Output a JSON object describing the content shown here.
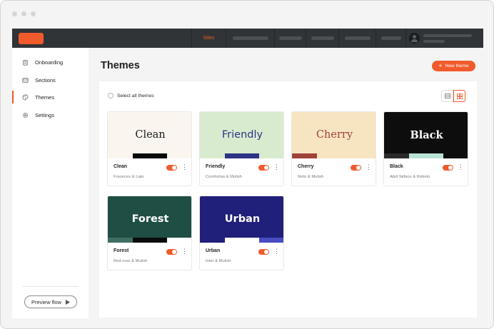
{
  "topbar": {
    "sites_label": "Sites"
  },
  "sidebar": {
    "items": [
      {
        "label": "Onboarding",
        "icon": "clipboard-icon"
      },
      {
        "label": "Sections",
        "icon": "layout-icon"
      },
      {
        "label": "Themes",
        "icon": "palette-icon",
        "active": true
      },
      {
        "label": "Settings",
        "icon": "gear-icon"
      }
    ],
    "preview_label": "Preview flow"
  },
  "main": {
    "title": "Themes",
    "new_theme_label": "New theme",
    "select_all_label": "Select all themes"
  },
  "colors": {
    "accent": "#f15a2b",
    "topbar": "#303437"
  },
  "themes": [
    {
      "name": "Clean",
      "preview_text": "Clean",
      "fonts": "Fraunces & Lato",
      "enabled": true,
      "bg": "#faf6ef",
      "fg": "#1a1a1a"
    },
    {
      "name": "Friendly",
      "preview_text": "Friendly",
      "fonts": "Comfortaa & Mulish",
      "enabled": true,
      "bg": "#d9ebcf",
      "fg": "#2d3485"
    },
    {
      "name": "Cherry",
      "preview_text": "Cherry",
      "fonts": "Noto & Mulish",
      "enabled": true,
      "bg": "#f7e4c1",
      "fg": "#a0433a"
    },
    {
      "name": "Black",
      "preview_text": "Black",
      "fonts": "Abril fatface & Roboto",
      "enabled": true,
      "bg": "#0d0d0d",
      "fg": "#ffffff"
    },
    {
      "name": "Forest",
      "preview_text": "Forest",
      "fonts": "Red rose & Mulish",
      "enabled": true,
      "bg": "#1f4e44",
      "fg": "#ffffff"
    },
    {
      "name": "Urban",
      "preview_text": "Urban",
      "fonts": "Inter & Mulish",
      "enabled": true,
      "bg": "#201f7a",
      "fg": "#ffffff"
    }
  ]
}
